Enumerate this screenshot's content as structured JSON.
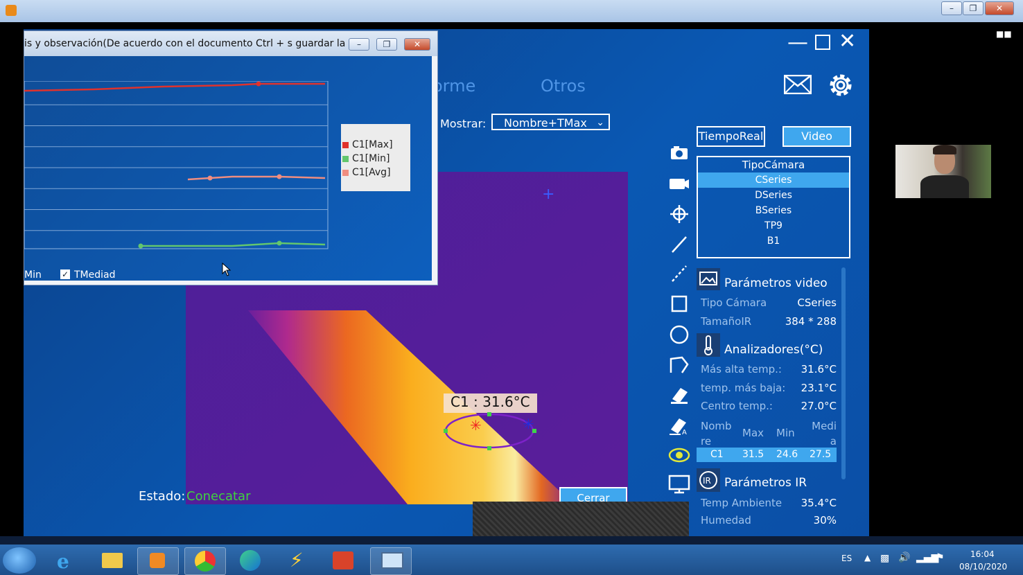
{
  "popup": {
    "title": "is y observación(De acuerdo con el documento Ctrl + s guardar la cur...",
    "legend": [
      {
        "label": "C1[Max]",
        "color": "#e0322c"
      },
      {
        "label": "C1[Min]",
        "color": "#63c66d"
      },
      {
        "label": "C1[Avg]",
        "color": "#ef8d80"
      }
    ],
    "check_min_label": "Min",
    "check_mediad_label": "TMediad"
  },
  "chart_data": {
    "type": "line",
    "series": [
      {
        "name": "C1[Max]",
        "color": "#e0322c"
      },
      {
        "name": "C1[Min]",
        "color": "#63c66d"
      },
      {
        "name": "C1[Avg]",
        "color": "#ef8d80"
      }
    ],
    "grid": true,
    "legend_position": "right"
  },
  "menu": {
    "tab_informe": "orme",
    "tab_otros": "Otros"
  },
  "mostrar": {
    "label": "Mostrar:",
    "value": "Nombre+TMax"
  },
  "thermal": {
    "spot_label": "C1 : 31.6°C"
  },
  "status": {
    "label": "Estado:",
    "value": "Conecatar",
    "value_color": "#3fd23f"
  },
  "cerrar_label": "Cerrar",
  "mode": {
    "realtime": "TiempoReal",
    "video": "Video"
  },
  "camera_type": {
    "header": "TipoCámara",
    "items": [
      "CSeries",
      "DSeries",
      "BSeries",
      "TP9",
      "B1"
    ],
    "selected": "CSeries"
  },
  "video_params": {
    "title": "Parámetros video",
    "rows": [
      {
        "label": "Tipo Cámara",
        "value": "CSeries"
      },
      {
        "label": "TamañoIR",
        "value": "384 * 288"
      }
    ]
  },
  "analyzers": {
    "title": "Analizadores(°C)",
    "rows": [
      {
        "label": "Más alta temp.:",
        "value": "31.6°C"
      },
      {
        "label": "temp. más baja:",
        "value": "23.1°C"
      },
      {
        "label": "Centro temp.:",
        "value": "27.0°C"
      }
    ],
    "table": {
      "headers": [
        "Nomb re",
        "Max",
        "Min",
        "Medi a"
      ],
      "row": [
        "C1",
        "31.5",
        "24.6",
        "27.5"
      ]
    }
  },
  "ir_params": {
    "title": "Parámetros IR",
    "rows": [
      {
        "label": "Temp Ambiente",
        "value": "35.4°C"
      },
      {
        "label": "Humedad",
        "value": "30%"
      }
    ]
  },
  "taskbar": {
    "lang": "ES",
    "time": "16:04",
    "date": "08/10/2020"
  }
}
